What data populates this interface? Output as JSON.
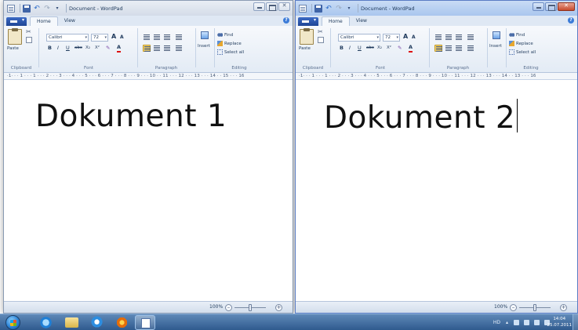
{
  "windows": [
    {
      "title": "Document - WordPad",
      "tabs": [
        "Home",
        "View"
      ],
      "clipboard": {
        "paste_label": "Paste",
        "group_label": "Clipboard"
      },
      "font": {
        "family": "Calibri",
        "size": "72",
        "group_label": "Font",
        "grow": "A",
        "shrink": "A",
        "bold": "B",
        "italic": "I",
        "underline": "U",
        "strike": "abc",
        "subscript": "X₂",
        "superscript": "X²",
        "highlight": "✎",
        "color": "A"
      },
      "paragraph": {
        "group_label": "Paragraph"
      },
      "insert": {
        "label": "Insert"
      },
      "editing": {
        "find": "Find",
        "replace": "Replace",
        "select_all": "Select all",
        "group_label": "Editing"
      },
      "ruler": "·1· · · 1 · · · 1 · · · 2 · · · 3 · · · 4 · · · 5 · · · 6 · · · 7 · · · 8 · · · 9 · · · 10 · · 11 · · · 12 · · · 13 · · · 14 · · 15 · · · 16",
      "document_text": "Dokument 1",
      "zoom": {
        "level": "100%",
        "minus": "–",
        "plus": "+",
        "fraction": 0.5
      }
    },
    {
      "title": "Document - WordPad",
      "tabs": [
        "Home",
        "View"
      ],
      "clipboard": {
        "paste_label": "Paste",
        "group_label": "Clipboard"
      },
      "font": {
        "family": "Calibri",
        "size": "72",
        "group_label": "Font",
        "grow": "A",
        "shrink": "A",
        "bold": "B",
        "italic": "I",
        "underline": "U",
        "strike": "abc",
        "subscript": "X₂",
        "superscript": "X²",
        "highlight": "✎",
        "color": "A"
      },
      "paragraph": {
        "group_label": "Paragraph"
      },
      "insert": {
        "label": "Insert"
      },
      "editing": {
        "find": "Find",
        "replace": "Replace",
        "select_all": "Select all",
        "group_label": "Editing"
      },
      "ruler": "·1· · · 1 · · · 1 · · · 2 · · · 3 · · · 4 · · · 5 · · · 6 · · · 7 · · · 8 · · · 9 · · · 10 · · 11 · · · 12 · · · 13 · · · 14 · · 13 · · · 16",
      "document_text": "Dokument 2",
      "zoom": {
        "level": "100%",
        "minus": "–",
        "plus": "+",
        "fraction": 0.5
      }
    }
  ],
  "taskbar": {
    "language": "HD",
    "time": "14:04",
    "date": "25.07.2011"
  },
  "colors": {
    "accent": "#3f64a7",
    "taskbar": "#2f5a8e",
    "active_title": "#a9c6ee"
  }
}
